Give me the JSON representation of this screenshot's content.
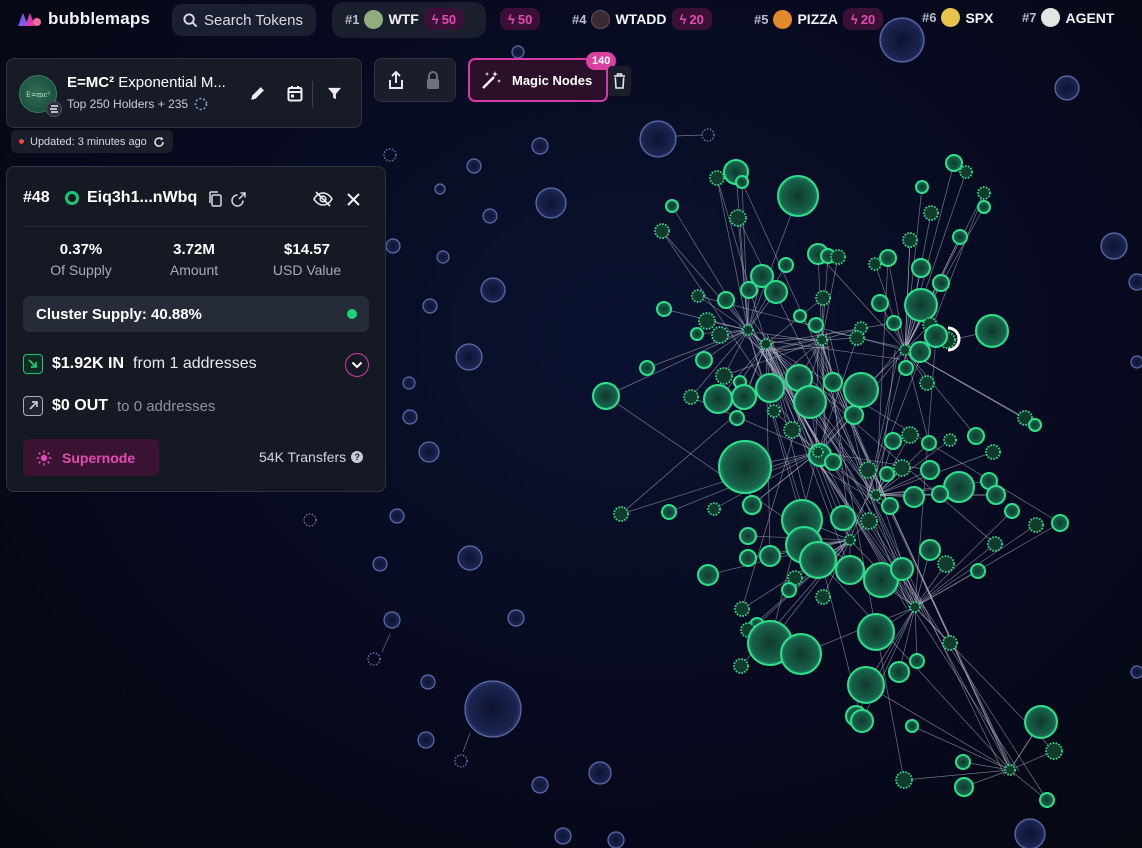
{
  "app": {
    "name": "bubblemaps"
  },
  "search": {
    "label": "Search Tokens"
  },
  "trending": [
    {
      "rank": "#1",
      "name": "WTF",
      "boost": "50",
      "avatar_color": "#8fae7e"
    },
    {
      "rank": "",
      "name": "",
      "boost": "50",
      "avatar_color": ""
    },
    {
      "rank": "#4",
      "name": "WTADD",
      "boost": "20",
      "avatar_color": "#3a2a33"
    },
    {
      "rank": "#5",
      "name": "PIZZA",
      "boost": "20",
      "avatar_color": "#e28a2b"
    },
    {
      "rank": "#6",
      "name": "SPX",
      "boost": "",
      "avatar_color": "#e6c34a"
    },
    {
      "rank": "#7",
      "name": "AGENT",
      "boost": "",
      "avatar_color": "#dfe7e2"
    }
  ],
  "token": {
    "name_bold": "E=MC²",
    "name_rest": "Exponential M...",
    "logo_text": "E=mc²",
    "subtitle": "Top 250 Holders + 235",
    "updated": "Updated: 3 minutes ago"
  },
  "magic_nodes": {
    "label": "Magic Nodes",
    "count": "140"
  },
  "address": {
    "rank": "#48",
    "short": "Eiq3h1...nWbq",
    "stats": [
      {
        "value": "0.37%",
        "label": "Of Supply"
      },
      {
        "value": "3.72M",
        "label": "Amount"
      },
      {
        "value": "$14.57",
        "label": "USD Value"
      }
    ],
    "cluster_supply": "Cluster Supply: 40.88%",
    "in": {
      "amount": "$1.92K IN",
      "text": "from 1 addresses"
    },
    "out": {
      "amount": "$0 OUT",
      "text": "to 0 addresses"
    },
    "supernode_label": "Supernode",
    "transfers": "54K Transfers"
  },
  "colors": {
    "accent_pink": "#d43aa8",
    "node_green": "#19c873",
    "node_blue": "#8ea0d8",
    "panel_bg": "#151923"
  }
}
